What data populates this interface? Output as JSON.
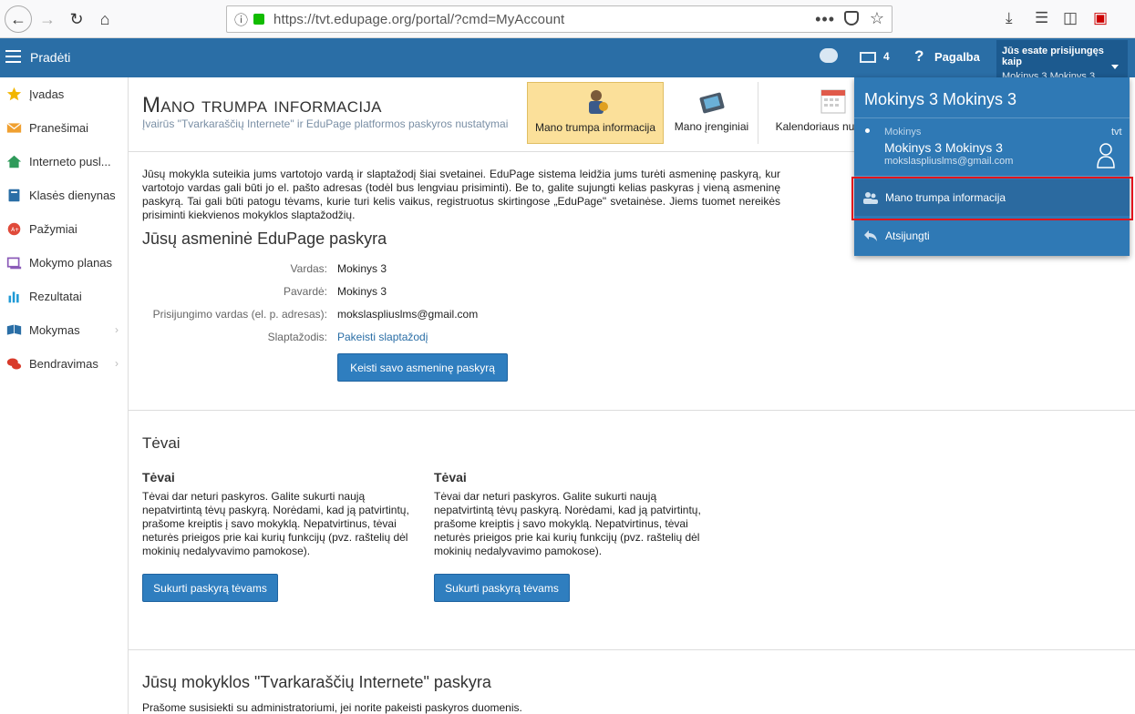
{
  "browser": {
    "url": "https://tvt.edupage.org/portal/?cmd=MyAccount",
    "menu_dots": "•••"
  },
  "topbar": {
    "start_label": "Pradėti",
    "mail_count": "4",
    "help_label": "Pagalba",
    "logged_in_as_label": "Jūs esate prisijungęs kaip",
    "logged_in_user": "Mokinys 3 Mokinys 3"
  },
  "sidebar": {
    "items": [
      {
        "label": "Įvadas",
        "icon": "star-icon",
        "color": "#f2b600"
      },
      {
        "label": "Pranešimai",
        "icon": "envelope-icon",
        "color": "#f0a030"
      },
      {
        "label": "Interneto pusl...",
        "icon": "home-icon",
        "color": "#2e9a5a"
      },
      {
        "label": "Klasės dienynas",
        "icon": "book-icon",
        "color": "#2a6ea6"
      },
      {
        "label": "Pažymiai",
        "icon": "grade-icon",
        "color": "#e04a3a"
      },
      {
        "label": "Mokymo planas",
        "icon": "plan-icon",
        "color": "#8a5ab8"
      },
      {
        "label": "Rezultatai",
        "icon": "chart-icon",
        "color": "#1f9ad6"
      },
      {
        "label": "Mokymas",
        "icon": "learning-icon",
        "color": "#2a6ea6"
      },
      {
        "label": "Bendravimas",
        "icon": "chat-icon",
        "color": "#d83a2a"
      }
    ]
  },
  "header": {
    "title": "Mano trumpa informacija",
    "subtitle": "Įvairūs \"Tvarkaraščių Internete\" ir EduPage platformos paskyros nustatymai",
    "tiles": [
      {
        "label": "Mano trumpa informacija"
      },
      {
        "label": "Mano įrenginiai"
      },
      {
        "label": "Kalendoriaus nu"
      }
    ]
  },
  "main": {
    "intro": "Jūsų mokykla suteikia jums vartotojo vardą ir slaptažodį šiai svetainei. EduPage sistema leidžia jums turėti asmeninę paskyrą, kur vartotojo vardas gali būti jo el. pašto adresas (todėl bus lengviau prisiminti). Be to, galite sujungti kelias paskyras į vieną asmeninę paskyrą. Tai gali būti patogu tėvams, kurie turi kelis vaikus, registruotus skirtingose „EduPage\" svetainėse. Jiems tuomet nereikės prisiminti kiekvienos mokyklos slaptažodžių.",
    "account_heading": "Jūsų asmeninė EduPage paskyra",
    "fields": [
      {
        "label": "Vardas:",
        "value": "Mokinys 3"
      },
      {
        "label": "Pavardė:",
        "value": "Mokinys 3"
      },
      {
        "label": "Prisijungimo vardas (el. p. adresas):",
        "value": "mokslaspliuslms@gmail.com"
      },
      {
        "label": "Slaptažodis:",
        "value": "Pakeisti slaptažodį"
      }
    ],
    "change_account_button": "Keisti savo asmeninę paskyrą",
    "parents_heading": "Tėvai",
    "parents": [
      {
        "heading": "Tėvai",
        "text": "Tėvai dar neturi paskyros. Galite sukurti naują nepatvirtintą tėvų paskyrą. Norėdami, kad ją patvirtintų, prašome kreiptis į savo mokyklą. Nepatvirtinus, tėvai neturės prieigos prie kai kurių funkcijų (pvz. raštelių dėl mokinių nedalyvavimo pamokose).",
        "button": "Sukurti paskyrą tėvams"
      },
      {
        "heading": "Tėvai",
        "text": "Tėvai dar neturi paskyros. Galite sukurti naują nepatvirtintą tėvų paskyrą. Norėdami, kad ją patvirtintų, prašome kreiptis į savo mokyklą. Nepatvirtinus, tėvai neturės prieigos prie kai kurių funkcijų (pvz. raštelių dėl mokinių nedalyvavimo pamokose).",
        "button": "Sukurti paskyrą tėvams"
      }
    ],
    "school_heading": "Jūsų mokyklos \"Tvarkaraščių Internete\" paskyra",
    "school_text": "Prašome susisiekti su administratoriumi, jei norite pakeisti paskyros duomenis."
  },
  "dropdown": {
    "title": "Mokinys 3 Mokinys 3",
    "role": "Mokinys",
    "name": "Mokinys 3 Mokinys 3",
    "email": "mokslaspliuslms@gmail.com",
    "school": "tvt",
    "item_info": "Mano trumpa informacija",
    "item_logout": "Atsijungti"
  },
  "colors": {
    "primary": "#2a6ea6",
    "highlight": "#e2141c",
    "tile_active": "#fbe09a"
  }
}
